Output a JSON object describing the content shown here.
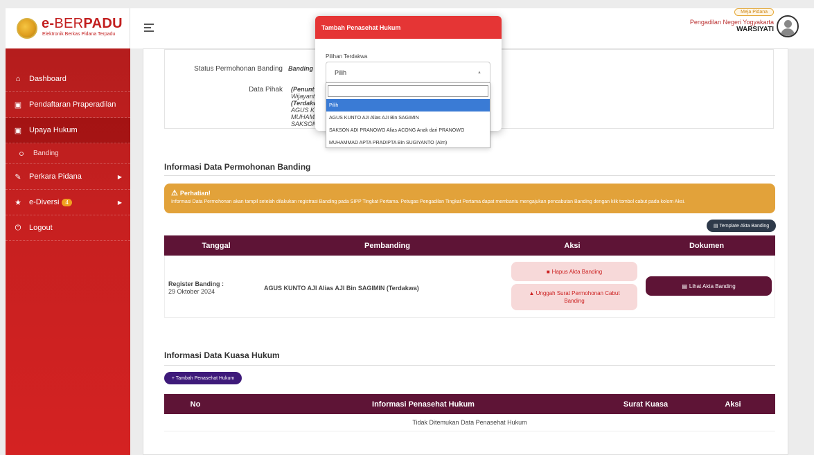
{
  "brand": {
    "title_e": "e-",
    "title_ber": "BER",
    "title_padu": "PADU",
    "subtitle": "Elektronik Berkas Pidana Terpadu"
  },
  "sidebar": {
    "items": [
      {
        "label": "Dashboard",
        "icon": "home-icon"
      },
      {
        "label": "Pendaftaran Praperadilan",
        "icon": "document-icon"
      },
      {
        "label": "Upaya Hukum",
        "icon": "document-icon"
      },
      {
        "label": "Banding",
        "icon": "circle-icon"
      },
      {
        "label": "Perkara Pidana",
        "icon": "edit-icon"
      },
      {
        "label": "e-Diversi",
        "icon": "star-icon",
        "badge": "4"
      },
      {
        "label": "Logout",
        "icon": "power-icon"
      }
    ]
  },
  "header": {
    "role": "Meja Pidana",
    "court": "Pengadilan Negeri Yogyakarta",
    "user": "WARSIYATI"
  },
  "detail": {
    "status_label": "Status Permohonan Banding",
    "status_value": "Banding",
    "pihak_label": "Data Pihak",
    "pihak_lines": [
      "(Penunt",
      "Wijayant",
      "(Terdakw",
      "AGUS K",
      "MUHAMI",
      "SAKSON"
    ]
  },
  "permohonan": {
    "title": "Informasi Data Permohonan Banding",
    "alert_title": "Perhatian!",
    "alert_text": "Informasi Data Permohonan akan tampil setelah dilakukan registrasi Banding pada SIPP Tingkat Pertama. Petugas Pengadilan Tingkat Pertama dapat membantu mengajukan pencabutan Banding dengan klik tombol cabut pada kolom Aksi.",
    "template_button": "Template Akta Banding",
    "columns": [
      "Tanggal",
      "Pembanding",
      "Aksi",
      "Dokumen"
    ],
    "row": {
      "reg_label": "Register Banding :",
      "reg_date": "29 Oktober 2024",
      "pembanding": "AGUS KUNTO AJI Alias AJI Bin SAGIMIN (Terdakwa)",
      "hapus": "Hapus Akta Banding",
      "unggah": "Unggah Surat Permohonan Cabut Banding",
      "lihat": "Lihat Akta Banding"
    }
  },
  "kuasa": {
    "title": "Informasi Data Kuasa Hukum",
    "add_button": "+ Tambah Penasehat Hukum",
    "columns": [
      "No",
      "Informasi Penasehat Hukum",
      "Surat Kuasa",
      "Aksi"
    ],
    "empty": "Tidak Ditemukan Data Penasehat Hukum"
  },
  "modal": {
    "title": "Tambah Penasehat Hukum",
    "field_label": "Pilihan Terdakwa",
    "selected": "Pilih",
    "search_placeholder": "",
    "options": [
      "Pilih",
      "AGUS KUNTO AJI Alias AJI Bin SAGIMIN",
      "SAKSON ADI PRANOWO Alias ACONG Anak dari PRANOWO",
      "MUHAMMAD APTA PRADIPTA Bin SUGIYANTO (Alm)"
    ]
  },
  "colors": {
    "sidebar": "#c62020",
    "table_header": "#5e1436",
    "alert": "#e2a23a",
    "modal_header": "#e53535",
    "dropdown_selected": "#3a7bd5"
  }
}
